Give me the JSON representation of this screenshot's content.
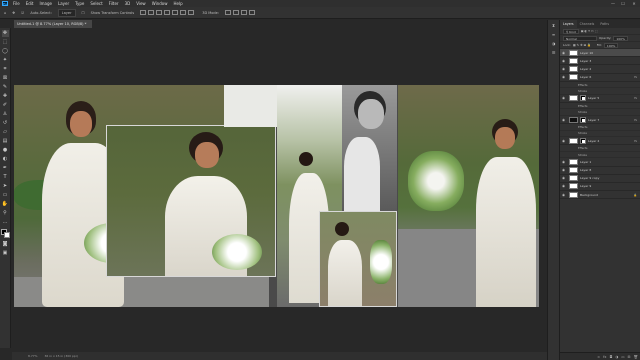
{
  "app": {
    "logo": "Ps"
  },
  "menu": [
    "File",
    "Edit",
    "Image",
    "Layer",
    "Type",
    "Select",
    "Filter",
    "3D",
    "View",
    "Window",
    "Help"
  ],
  "window_controls": {
    "minimize": "—",
    "maximize": "☐",
    "close": "✕"
  },
  "options_bar": {
    "auto_select_label": "Auto-Select:",
    "auto_select_value": "Layer",
    "show_transform": "Show Transform Controls",
    "mode_3d": "3D Mode:"
  },
  "document_tab": {
    "title": "Untitled-1 @ 8.77% (Layer 10, RGB/8) *",
    "close": "×"
  },
  "status_bar": {
    "zoom": "8.77%",
    "doc_info": "36 in x 15 in (300 ppi)"
  },
  "panel": {
    "tabs": [
      "Layers",
      "Channels",
      "Paths"
    ],
    "kind_filter": "Kind",
    "blend_mode": "Normal",
    "opacity_label": "Opacity:",
    "opacity_value": "100%",
    "lock_label": "Lock:",
    "fill_label": "Fill:",
    "fill_value": "100%"
  },
  "layers": [
    {
      "name": "Layer 10",
      "selected": true,
      "thumb": "light"
    },
    {
      "name": "Layer 3",
      "thumb": "light"
    },
    {
      "name": "Layer 2",
      "thumb": "light"
    },
    {
      "name": "Layer 6",
      "thumb": "light",
      "fx": "fx"
    },
    {
      "name": "Effects",
      "sub": true
    },
    {
      "name": "Stroke",
      "sub": true
    },
    {
      "name": "Layer 5",
      "thumb": "light",
      "mask": true,
      "fx": "fx"
    },
    {
      "name": "Effects",
      "sub": true
    },
    {
      "name": "Stroke",
      "sub": true
    },
    {
      "name": "Layer 7",
      "thumb": "dark",
      "mask": true,
      "fx": "fx"
    },
    {
      "name": "Effects",
      "sub": true
    },
    {
      "name": "Stroke",
      "sub": true
    },
    {
      "name": "Layer 4",
      "thumb": "light",
      "mask": true,
      "fx": "fx"
    },
    {
      "name": "Effects",
      "sub": true
    },
    {
      "name": "Stroke",
      "sub": true
    },
    {
      "name": "Layer 1",
      "thumb": "light"
    },
    {
      "name": "Layer 8",
      "thumb": "light"
    },
    {
      "name": "Layer 9 copy",
      "thumb": "light"
    },
    {
      "name": "Layer 9",
      "thumb": "light"
    },
    {
      "name": "Background",
      "thumb": "light",
      "locked": true
    }
  ],
  "icons": {
    "tools": [
      "move-icon",
      "marquee-icon",
      "lasso-icon",
      "magic-wand-icon",
      "crop-icon",
      "frame-icon",
      "eyedropper-icon",
      "spot-healing-icon",
      "brush-icon",
      "stamp-icon",
      "history-brush-icon",
      "eraser-icon",
      "gradient-icon",
      "blur-icon",
      "dodge-icon",
      "pen-icon",
      "type-icon",
      "path-select-icon",
      "rectangle-icon",
      "hand-icon",
      "zoom-icon"
    ]
  }
}
